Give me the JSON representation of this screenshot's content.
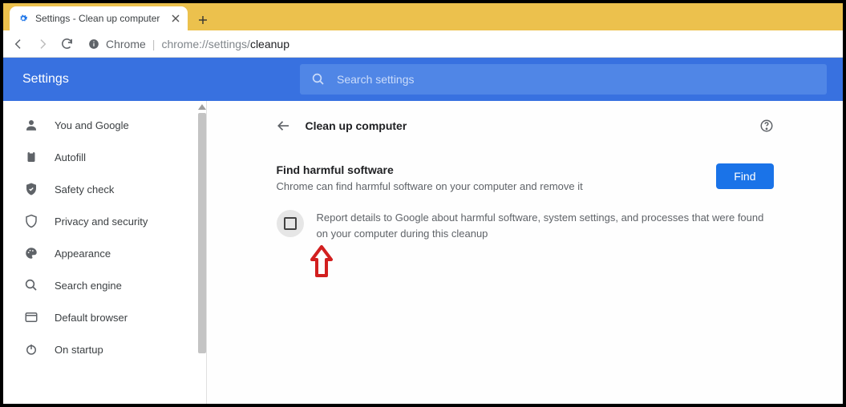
{
  "tab": {
    "title": "Settings - Clean up computer"
  },
  "url": {
    "scheme": "Chrome",
    "path_head": "chrome://settings/",
    "path_tail": "cleanup"
  },
  "header": {
    "title": "Settings"
  },
  "search": {
    "placeholder": "Search settings"
  },
  "sidebar": {
    "items": [
      {
        "label": "You and Google",
        "icon": "person"
      },
      {
        "label": "Autofill",
        "icon": "clipboard"
      },
      {
        "label": "Safety check",
        "icon": "shield-check"
      },
      {
        "label": "Privacy and security",
        "icon": "shield"
      },
      {
        "label": "Appearance",
        "icon": "palette"
      },
      {
        "label": "Search engine",
        "icon": "search"
      },
      {
        "label": "Default browser",
        "icon": "browser"
      },
      {
        "label": "On startup",
        "icon": "power"
      }
    ]
  },
  "panel": {
    "title": "Clean up computer",
    "section_title": "Find harmful software",
    "section_sub": "Chrome can find harmful software on your computer and remove it",
    "find_label": "Find",
    "report_text": "Report details to Google about harmful software, system settings, and processes that were found on your computer during this cleanup"
  }
}
